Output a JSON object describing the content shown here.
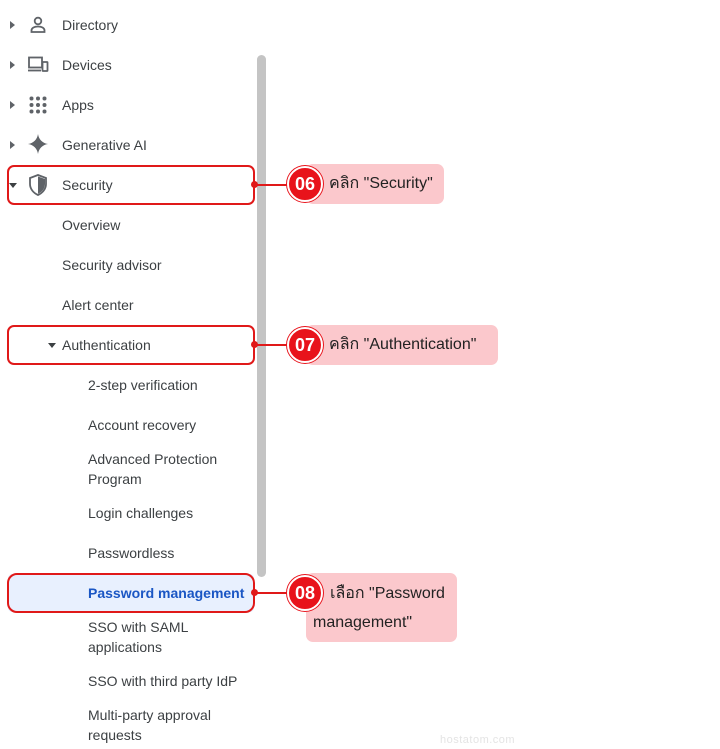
{
  "nav": {
    "directory": "Directory",
    "devices": "Devices",
    "apps": "Apps",
    "generative_ai": "Generative AI",
    "security": "Security"
  },
  "security_sub": {
    "overview": "Overview",
    "security_advisor": "Security advisor",
    "alert_center": "Alert center",
    "authentication": "Authentication"
  },
  "auth_sub": {
    "two_step": "2-step verification",
    "account_recovery": "Account recovery",
    "advanced_protection_1": "Advanced Protection",
    "advanced_protection_2": "Program",
    "login_challenges": "Login challenges",
    "passwordless": "Passwordless",
    "password_management": "Password management",
    "sso_saml_1": "SSO with SAML",
    "sso_saml_2": "applications",
    "sso_third_party": "SSO with third party IdP",
    "multi_party_1": "Multi-party approval",
    "multi_party_2": "requests"
  },
  "callouts": [
    {
      "number": "06",
      "text": "คลิก \"Security\""
    },
    {
      "number": "07",
      "text": "คลิก \"Authentication\""
    },
    {
      "number": "08",
      "text_line1": "เลือก \"Password",
      "text_line2": "management\""
    }
  ],
  "watermark": "hostatom.com",
  "colors": {
    "highlight_red": "#e01919",
    "callout_bg": "#fbc8cc",
    "active_bg": "#e8f0fe",
    "active_text": "#1a56c4"
  }
}
